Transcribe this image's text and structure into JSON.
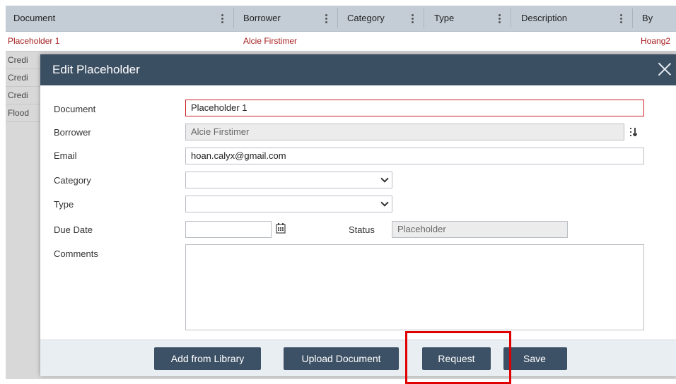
{
  "grid": {
    "columns": [
      "Document",
      "Borrower",
      "Category",
      "Type",
      "Description",
      "By"
    ],
    "rows": [
      {
        "document": "Placeholder 1",
        "borrower": "Alcie Firstimer",
        "by": "Hoang2",
        "selected": true
      },
      {
        "document": "Credi"
      },
      {
        "document": "Credi"
      },
      {
        "document": "Credi"
      },
      {
        "document": "Flood"
      }
    ]
  },
  "modal": {
    "title": "Edit Placeholder",
    "fields": {
      "document": {
        "label": "Document",
        "value": "Placeholder 1"
      },
      "borrower": {
        "label": "Borrower",
        "value": "Alcie Firstimer"
      },
      "email": {
        "label": "Email",
        "value": "hoan.calyx@gmail.com"
      },
      "category": {
        "label": "Category",
        "value": ""
      },
      "type": {
        "label": "Type",
        "value": ""
      },
      "due_date": {
        "label": "Due Date",
        "value": ""
      },
      "status": {
        "label": "Status",
        "value": "Placeholder"
      },
      "comments": {
        "label": "Comments",
        "value": ""
      }
    },
    "buttons": {
      "add_from_library": "Add from Library",
      "upload_document": "Upload Document",
      "request": "Request",
      "save": "Save"
    }
  },
  "colors": {
    "header_bg": "#3b4f63",
    "button_bg": "#3d5166",
    "required_border": "#cc2222",
    "selected_row_text": "#a51b1b",
    "highlight": "#e00000"
  }
}
